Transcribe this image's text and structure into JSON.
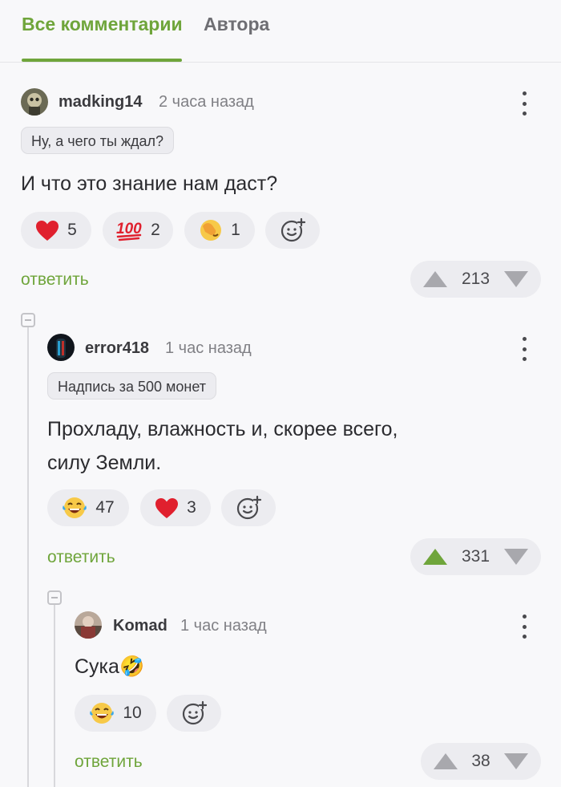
{
  "tabs": [
    {
      "label": "Все комментарии",
      "active": true
    },
    {
      "label": "Автора",
      "active": false
    }
  ],
  "accent_color": "#6fa53b",
  "comments": [
    {
      "username": "madking14",
      "time": "2 часа назад",
      "badge": "Ну, а чего ты ждал?",
      "text": "И что это знание нам даст?",
      "reactions": [
        {
          "icon": "heart-icon",
          "count": "5"
        },
        {
          "icon": "hundred-icon",
          "count": "2"
        },
        {
          "icon": "facepalm-icon",
          "count": "1"
        }
      ],
      "reply_label": "ответить",
      "rating": "213",
      "upvoted": false
    },
    {
      "username": "error418",
      "time": "1 час назад",
      "badge": "Надпись за 500 монет",
      "text_line1": "Прохладу, влажность и, скорее всего,",
      "text_line2": "силу Земли.",
      "reactions": [
        {
          "icon": "laughing-tears-icon",
          "count": "47"
        },
        {
          "icon": "heart-icon",
          "count": "3"
        }
      ],
      "reply_label": "ответить",
      "rating": "331",
      "upvoted": true
    },
    {
      "username": "Komad",
      "time": "1 час назад",
      "text": "Сука🤣",
      "reactions": [
        {
          "icon": "laughing-tears-icon",
          "count": "10"
        }
      ],
      "reply_label": "ответить",
      "rating": "38",
      "upvoted": false
    }
  ]
}
